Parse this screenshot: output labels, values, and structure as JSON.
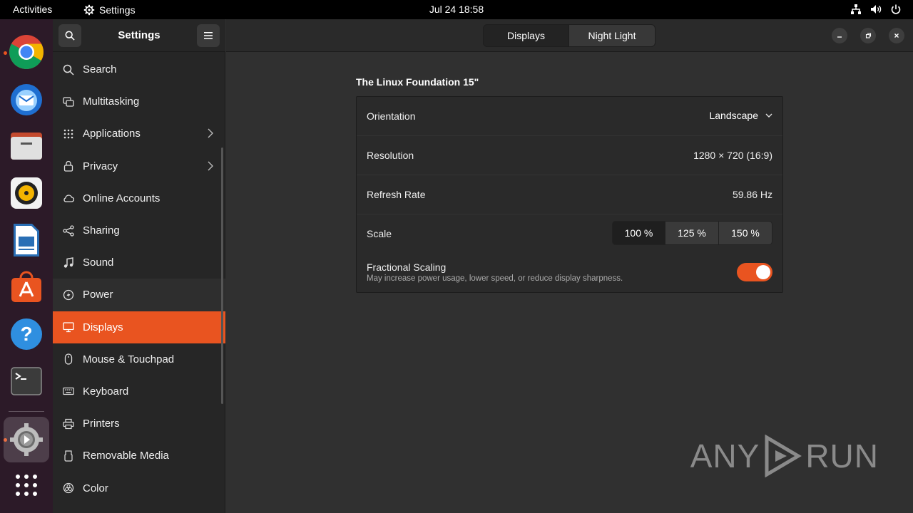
{
  "topbar": {
    "activities": "Activities",
    "app_name": "Settings",
    "clock": "Jul 24  18:58",
    "tray_icons": [
      "network-icon",
      "volume-icon",
      "power-icon"
    ]
  },
  "dock": {
    "items": [
      "chrome",
      "thunderbird",
      "files",
      "rhythmbox",
      "libreoffice-writer",
      "app-center",
      "help",
      "terminal",
      "settings"
    ],
    "show_apps": "show-apps-grid"
  },
  "settings": {
    "sidebar_title": "Settings",
    "nav": [
      {
        "label": "Search",
        "icon": "search-icon"
      },
      {
        "label": "Multitasking",
        "icon": "multitasking-icon"
      },
      {
        "label": "Applications",
        "icon": "apps-grid-icon",
        "chevron": true
      },
      {
        "label": "Privacy",
        "icon": "lock-icon",
        "chevron": true
      },
      {
        "label": "Online Accounts",
        "icon": "cloud-icon"
      },
      {
        "label": "Sharing",
        "icon": "share-icon"
      },
      {
        "label": "Sound",
        "icon": "music-note-icon"
      },
      {
        "label": "Power",
        "icon": "power-bolt-icon"
      },
      {
        "label": "Displays",
        "icon": "monitor-icon",
        "selected": true
      },
      {
        "label": "Mouse & Touchpad",
        "icon": "mouse-icon"
      },
      {
        "label": "Keyboard",
        "icon": "keyboard-icon"
      },
      {
        "label": "Printers",
        "icon": "printer-icon"
      },
      {
        "label": "Removable Media",
        "icon": "removable-media-icon"
      },
      {
        "label": "Color",
        "icon": "color-icon"
      }
    ],
    "tabs": [
      "Displays",
      "Night Light"
    ],
    "active_tab": "Displays"
  },
  "display": {
    "monitor_name": "The Linux Foundation 15\"",
    "orientation_label": "Orientation",
    "orientation_value": "Landscape",
    "resolution_label": "Resolution",
    "resolution_value": "1280 × 720 (16:9)",
    "refresh_label": "Refresh Rate",
    "refresh_value": "59.86 Hz",
    "scale_label": "Scale",
    "scale_options": [
      "100 %",
      "125 %",
      "150 %"
    ],
    "scale_selected": "100 %",
    "fractional_label": "Fractional Scaling",
    "fractional_desc": "May increase power usage, lower speed, or reduce display sharpness.",
    "fractional_enabled": true
  },
  "watermark": {
    "left": "ANY",
    "right": "RUN"
  },
  "colors": {
    "accent": "#e95420",
    "dock_bg": "#2c1a28",
    "sidebar_bg": "#262626",
    "content_bg": "#303030"
  }
}
